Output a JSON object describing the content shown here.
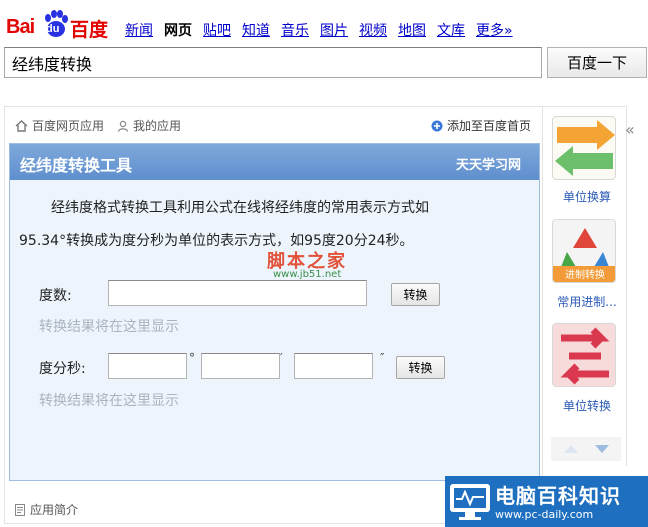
{
  "brand": {
    "logo_left": "Bai",
    "logo_paw_text": "du",
    "logo_right": "百度"
  },
  "nav": [
    "新闻",
    "网页",
    "贴吧",
    "知道",
    "音乐",
    "图片",
    "视频",
    "地图",
    "文库",
    "更多»"
  ],
  "nav_active": "网页",
  "search": {
    "query": "经纬度转换",
    "button": "百度一下"
  },
  "app_tabs": {
    "baidu_apps": "百度网页应用",
    "my_apps": "我的应用",
    "add_home": "添加至百度首页"
  },
  "tool": {
    "title": "经纬度转换工具",
    "brand": "天天学习网",
    "desc_line1": "经纬度格式转换工具利用公式在线将经纬度的常用表示方式如",
    "desc_line2": "95.34°转换成为度分秒为单位的表示方式，如95度20分24秒。",
    "degree_label": "度数:",
    "dms_label": "度分秒:",
    "convert_btn_1": "转换",
    "convert_btn_2": "转换",
    "result_placeholder_1": "转换结果将在这里显示",
    "result_placeholder_2": "转换结果将在这里显示",
    "unit_deg": "°",
    "unit_min": "′",
    "unit_sec": "″"
  },
  "watermark": {
    "text": "脚本之家",
    "url": "www.jb51.net"
  },
  "footer": {
    "app_intro": "应用简介"
  },
  "sidebar": {
    "collapse": "«",
    "items": [
      {
        "label": "单位换算"
      },
      {
        "label": "常用进制..."
      },
      {
        "label": "单位转换"
      }
    ],
    "icon2_caption": "进制转换"
  },
  "corner_logo": {
    "name": "电脑百科知识",
    "url": "www.pc-daily.com"
  }
}
